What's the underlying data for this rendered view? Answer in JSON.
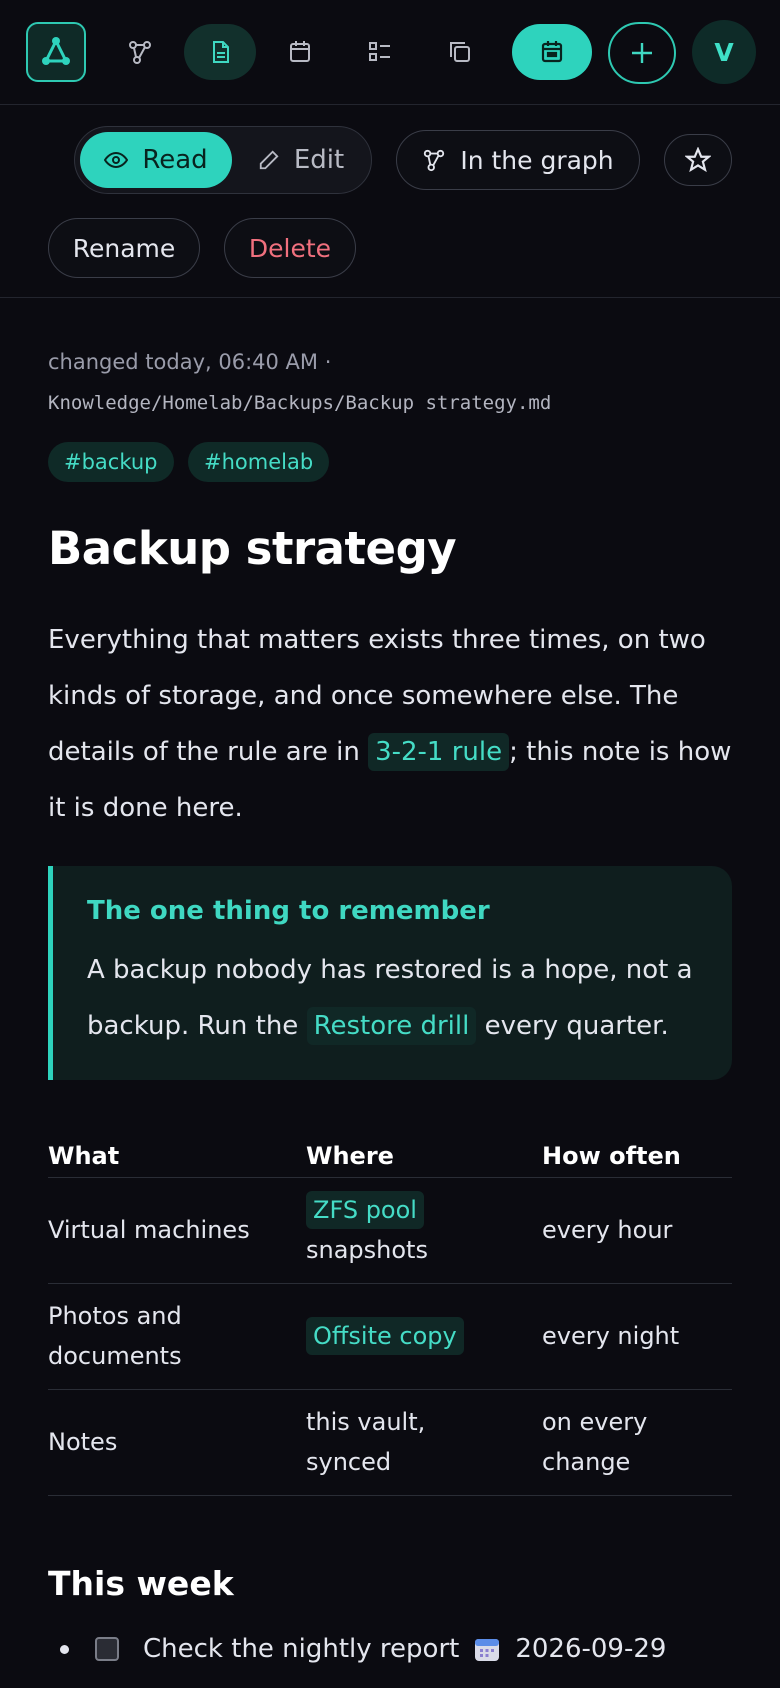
{
  "nav": {
    "avatar_initial": "V",
    "icons": [
      "logo-icon",
      "graph-icon",
      "document-icon",
      "calendar-icon",
      "checklist-icon",
      "copy-icon",
      "today-calendar-icon",
      "plus-icon"
    ]
  },
  "toolbar": {
    "read_label": "Read",
    "edit_label": "Edit",
    "graph_label": "In the graph",
    "rename_label": "Rename",
    "delete_label": "Delete"
  },
  "note": {
    "meta": "changed today, 06:40 AM  ·",
    "path": "Knowledge/Homelab/Backups/Backup strategy.md",
    "tags": [
      "#backup",
      "#homelab"
    ],
    "title": "Backup strategy",
    "intro_before": "Everything that matters exists three times, on two kinds of storage, and once somewhere else. The details of the rule are in ",
    "intro_link": "3-2-1 rule",
    "intro_after": "; this note is how it is done here.",
    "callout_title": "The one thing to remember",
    "callout_before": "A backup nobody has restored is a hope, not a backup. Run the ",
    "callout_link": "Restore drill",
    "callout_after": " every quarter."
  },
  "table": {
    "headers": [
      "What",
      "Where",
      "How often"
    ],
    "rows": [
      {
        "what": "Virtual machines",
        "where_link": "ZFS pool",
        "where_text": "snapshots",
        "how": "every hour"
      },
      {
        "what": "Photos and documents",
        "where_link": "Offsite copy",
        "where_text": "",
        "how": "every night"
      },
      {
        "what": "Notes",
        "where_link": "",
        "where_text": "this vault, synced",
        "how": "on every change"
      }
    ]
  },
  "section": {
    "title": "This week",
    "task_text": "Check the nightly report",
    "task_date": "2026-09-29"
  },
  "colors": {
    "accent": "#2ed3bd",
    "background": "#0b0b11",
    "delete": "#f0707e"
  }
}
